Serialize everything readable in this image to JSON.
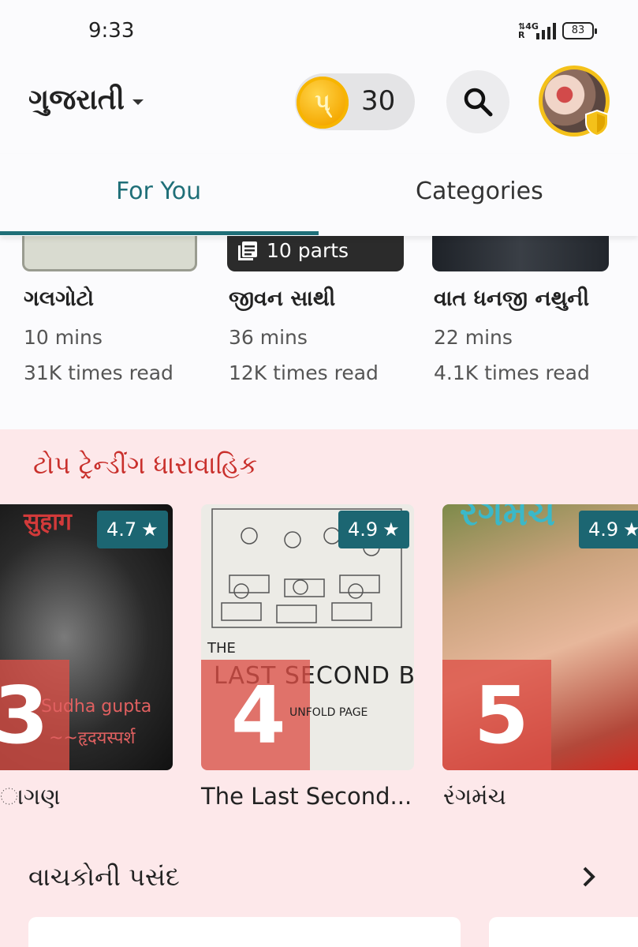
{
  "status_bar": {
    "time": "9:33",
    "network": "4G",
    "battery": "83"
  },
  "header": {
    "language": "ગુજરાતી",
    "coins": "30",
    "coin_symbol": "પ્",
    "icons": {
      "search": "search-icon",
      "avatar": "profile-avatar",
      "shield": "shield-badge-icon"
    }
  },
  "tabs": [
    {
      "label": "For You",
      "active": true
    },
    {
      "label": "Categories",
      "active": false
    }
  ],
  "stories": [
    {
      "title": "ગલગોટો",
      "time": "10 mins",
      "reads": "31K times read",
      "parts": ""
    },
    {
      "title": "જીવન સાથી",
      "time": "36 mins",
      "reads": "12K times read",
      "parts": "10 parts"
    },
    {
      "title": "વાત ધનજી નથુની",
      "time": "22 mins",
      "reads": "4.1K times read",
      "parts": ""
    }
  ],
  "trending": {
    "title": "ટોપ ટ્રેન્ડીંગ ધારાવાહિક",
    "items": [
      {
        "rank": "3",
        "rating": "4.7",
        "name": "ાગણ",
        "cover_text_1": "Sudha gupta",
        "cover_text_2": "~~हृदयस्पर्श",
        "cover_text_top": "सुहाग"
      },
      {
        "rank": "4",
        "rating": "4.9",
        "name": "The Last Second...",
        "cover_text_1": "LAST SECOND BENCH",
        "cover_text_2": "UNFOLD PAGE",
        "cover_text_top": "THE"
      },
      {
        "rank": "5",
        "rating": "4.9",
        "name": "રંગમંચ",
        "cover_text_top": "રંગમંચ"
      }
    ]
  },
  "readers_choice": {
    "title": "વાચકોની પસંદ"
  },
  "colors": {
    "accent": "#1f6f78",
    "trending_bg": "#fde8ea",
    "trending_title": "#c9302c",
    "rating_bg": "#1c6672",
    "rank_box": "#dc5046"
  }
}
